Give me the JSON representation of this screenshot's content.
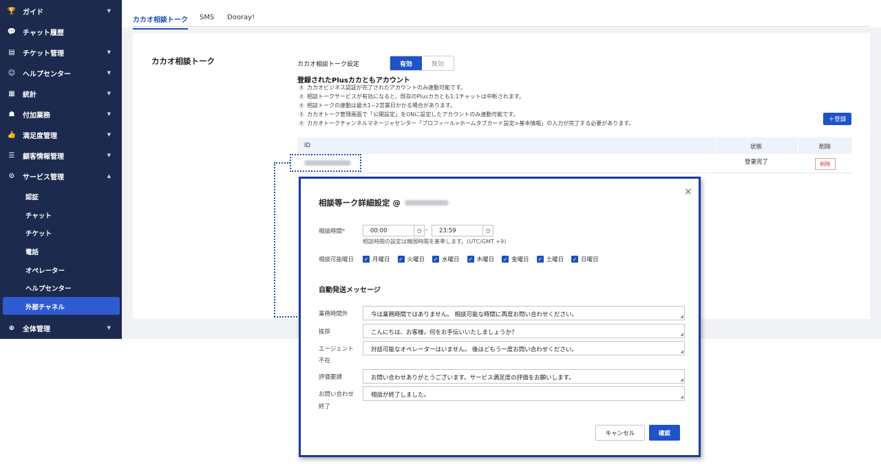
{
  "sidebar": {
    "items": [
      {
        "label": "ガイド",
        "icon": "trophy-icon",
        "glyph": "🏆"
      },
      {
        "label": "チャット履歴",
        "icon": "chat-icon",
        "glyph": "💬"
      },
      {
        "label": "チケット管理",
        "icon": "ticket-icon",
        "glyph": "▤"
      },
      {
        "label": "ヘルプセンター",
        "icon": "help-icon",
        "glyph": "☺"
      },
      {
        "label": "統計",
        "icon": "stats-icon",
        "glyph": "▦"
      },
      {
        "label": "付加業務",
        "icon": "user-plus-icon",
        "glyph": "☗"
      },
      {
        "label": "満足度管理",
        "icon": "thumbs-up-icon",
        "glyph": "👍"
      },
      {
        "label": "顧客情報管理",
        "icon": "customer-icon",
        "glyph": "☰"
      },
      {
        "label": "サービス管理",
        "icon": "gear-icon",
        "glyph": "⚙"
      }
    ],
    "sub_items": [
      "認証",
      "チャット",
      "チケット",
      "電話",
      "オペレーター",
      "ヘルプセンター",
      "外部チャネル"
    ],
    "bottom_item": {
      "label": "全体管理",
      "icon": "plus-circle-icon",
      "glyph": "⊕"
    }
  },
  "tabs": [
    "カカオ相談トーク",
    "SMS",
    "Dooray!"
  ],
  "panel": {
    "title": "カカオ相談トーク",
    "setting_label": "カカオ相談トーク設定",
    "toggle_on": "有効",
    "toggle_off": "無効",
    "account_title": "登録されたPlusカカともアカウント",
    "notes": [
      "カカオビジネス認証が完了されたアカウントのみ連動可能です。",
      "相談トークサービスが有効になると、既存のPlusカカとも1:1チャットは中断されます。",
      "相談トークの連動は最大1~2営業日かかる場合があります。",
      "カカオトーク管理画面で「公開設定」をONに設定したアカウントのみ連動可能です。",
      "カカオトークチャンネルマネージャセンター「プロフィール>ホームタブカード設定>基本情報」の入力が完了する必要があります。"
    ],
    "register_button": "＋登録",
    "table_headers": {
      "id": "ID",
      "status": "状態",
      "delete": "削除"
    },
    "row": {
      "status": "登录完了",
      "delete": "削除"
    }
  },
  "modal": {
    "title": "相談等ーク詳細設定 @",
    "close": "×",
    "hours_label": "相談時間",
    "required": "*",
    "time_start": "00:00",
    "time_end": "23:59",
    "time_sep": "-",
    "time_note": "相談時間の設定は韓国時間を基準します。(UTC/GMT +9)",
    "days_label": "相談可能曜日",
    "days": [
      "月曜日",
      "火曜日",
      "水曜日",
      "木曜日",
      "金曜日",
      "土曜日",
      "日曜日"
    ],
    "section_title": "自動発送メッセージ",
    "messages": [
      {
        "label": "業務時間外",
        "text": "今は業務時間ではありません。 相談可能な時間に再度お問い合わせください。"
      },
      {
        "label": "挨拶",
        "text": "こんにちは、お客様。何をお手伝いいたしましょうか？"
      },
      {
        "label": "エージェント",
        "label2": "不在",
        "text": "対話可能なオペレーターはいません。 後ほどもう一度お問い合わせください。"
      },
      {
        "label": "評価要請",
        "text": "お問い合わせありがとうございます。サービス満足度の評価をお願いします。"
      },
      {
        "label": "お問い合わせ",
        "label2": "終了",
        "text": "相談が終了しました。"
      }
    ],
    "cancel_button": "キャンセル",
    "confirm_button": "確認"
  },
  "colors": {
    "sidebar_bg": "#1c2a4d",
    "accent": "#2052c8",
    "active_sub": "#2e5bd2",
    "modal_border": "#1c3a9e"
  }
}
